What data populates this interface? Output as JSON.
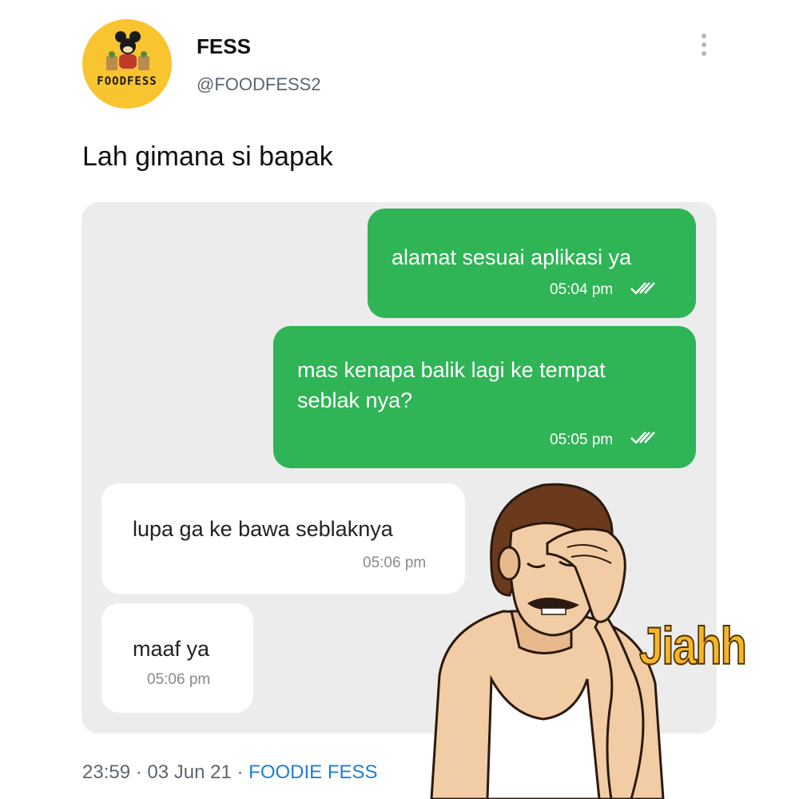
{
  "tweet": {
    "avatar_logo_text": "FOODFESS",
    "display_name": "FESS",
    "handle": "@FOODFESS2",
    "text": "Lah gimana si bapak",
    "time": "23:59",
    "separator": "·",
    "date": "03 Jun 21",
    "source": "FOODIE FESS"
  },
  "chat": {
    "messages": [
      {
        "direction": "outgoing",
        "text": "alamat sesuai aplikasi ya",
        "time": "05:04 pm",
        "status_icon": "double-check-icon"
      },
      {
        "direction": "outgoing",
        "text": "mas kenapa balik lagi ke tempat seblak nya?",
        "time": "05:05 pm",
        "status_icon": "double-check-icon"
      },
      {
        "direction": "incoming",
        "text": "lupa ga ke bawa seblaknya",
        "time": "05:06 pm"
      },
      {
        "direction": "incoming",
        "text": "maaf ya",
        "time": "05:06 pm"
      }
    ]
  },
  "sticker": {
    "text": "Jiahh"
  },
  "colors": {
    "outgoing_bubble": "#2fb456",
    "incoming_bubble": "#ffffff",
    "chat_background": "#ececec",
    "avatar_background": "#f8c430",
    "source_link": "#1d7fd6"
  }
}
